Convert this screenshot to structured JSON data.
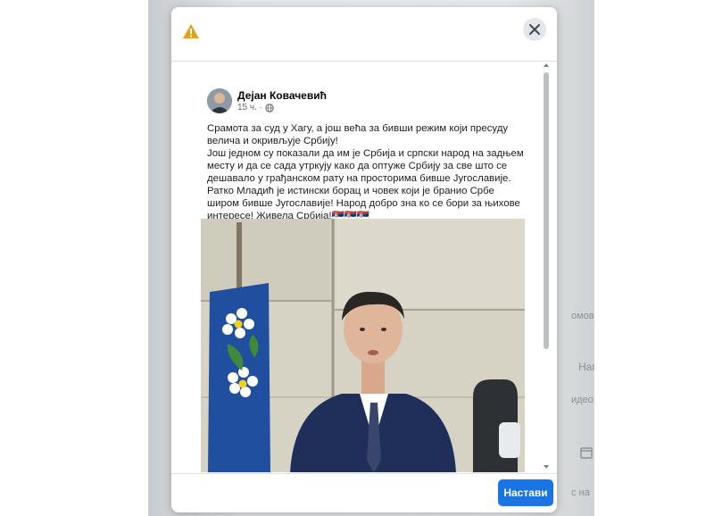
{
  "modal": {
    "next_button_label": "Настави"
  },
  "post": {
    "author": "Дејан Ковачевић",
    "time": "15 ч. ·",
    "paragraphs": [
      "Срамота за суд у Хагу, а још већа за бивши режим који пресуду велича и окривљује Србију!",
      "Још једном су показали да им је Србија и српски народ на задњем месту и да се сада утркују како да оптуже Србију за све што се дешавало у грађанском рату на просторима бивше Југославије.",
      "Ратко Младић је истински борац и човек који је бранио Србе широм бивше Југославије! Народ добро зна ко се бори за њихове интересе! Живела Србија!🇷🇸🇷🇸🇷🇸"
    ]
  },
  "background": {
    "text_1": "омовиц",
    "text_2": "Наг",
    "text_3": "идео",
    "text_4": "с на"
  },
  "colors": {
    "accent": "#1b74e4",
    "warning": "#e0a21b"
  },
  "icons": [
    "warning-icon",
    "close-icon",
    "globe-icon",
    "calendar-icon"
  ]
}
